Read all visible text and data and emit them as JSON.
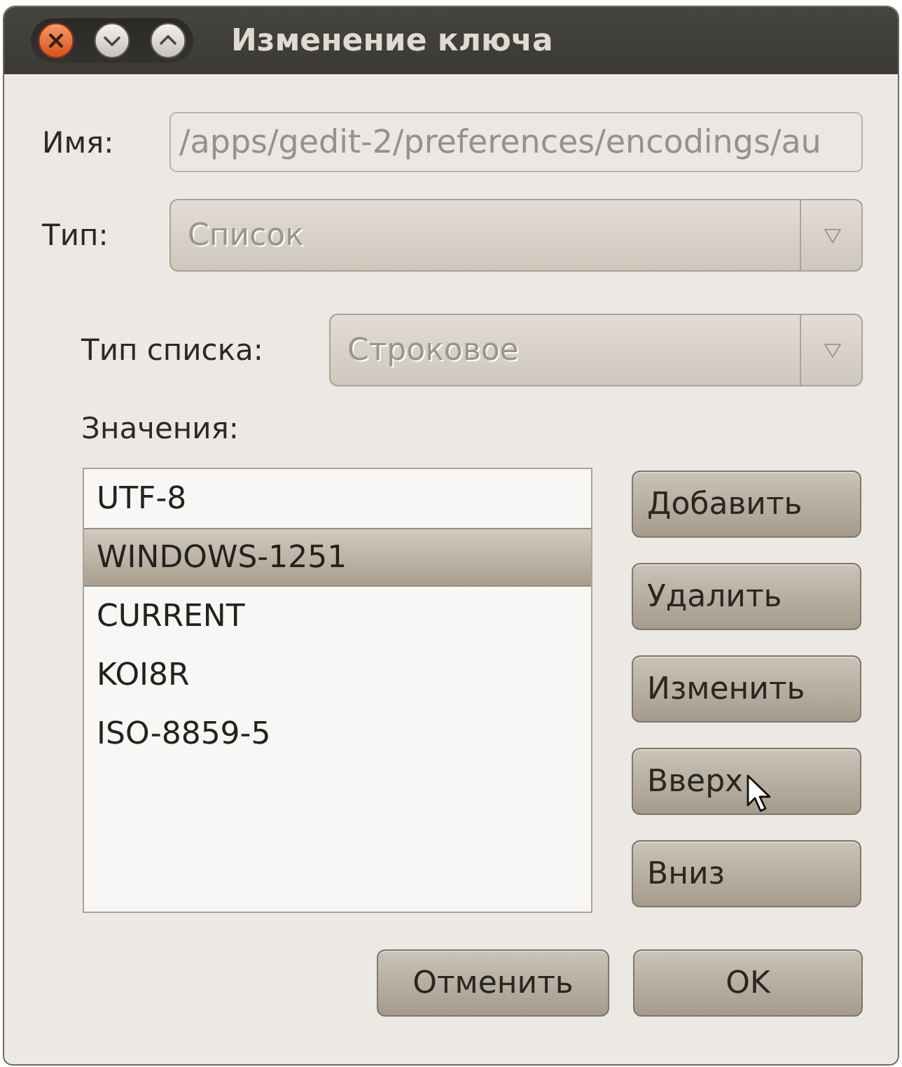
{
  "window": {
    "title": "Изменение ключа"
  },
  "name_field": {
    "label": "Имя:",
    "value": "/apps/gedit-2/preferences/encodings/au",
    "disabled": true
  },
  "type_field": {
    "label": "Тип:",
    "value": "Список",
    "disabled": true
  },
  "list_type_field": {
    "label": "Тип списка:",
    "value": "Строковое",
    "disabled": true
  },
  "values": {
    "label": "Значения:",
    "items": [
      {
        "text": "UTF-8",
        "selected": false
      },
      {
        "text": "WINDOWS-1251",
        "selected": true
      },
      {
        "text": "CURRENT",
        "selected": false
      },
      {
        "text": "KOI8R",
        "selected": false
      },
      {
        "text": "ISO-8859-5",
        "selected": false
      }
    ]
  },
  "list_buttons": [
    "Добавить",
    "Удалить",
    "Изменить",
    "Вверх",
    "Вниз"
  ],
  "dialog_buttons": [
    "Отменить",
    "OK"
  ]
}
